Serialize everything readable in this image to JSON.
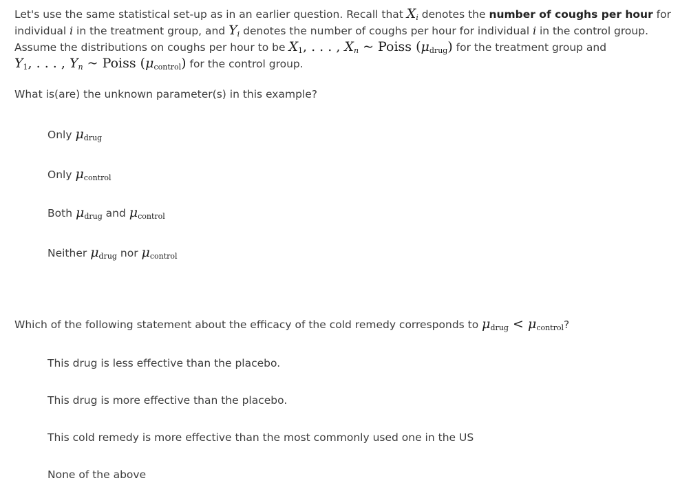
{
  "intro": {
    "l1_a": "Let's use the same statistical set-up as in an earlier question. Recall that ",
    "l1_b": " denotes the ",
    "l1_bold": "number of coughs per hour",
    "l1_c": " for",
    "l2_a": "individual ",
    "l2_b": " in the treatment group, and ",
    "l2_c": " denotes the number of coughs per hour for individual ",
    "l2_d": " in the control group.",
    "l3_a": "Assume the distributions on coughs per hour to be ",
    "l3_b": " for the treatment group and",
    "l4_b": " for the control group."
  },
  "math": {
    "X": "X",
    "Y": "Y",
    "i": "i",
    "n": "n",
    "one": "1",
    "ellipsis": ", . . . , ",
    "tilde": " ~ ",
    "poiss": "Poiss",
    "lp": "(",
    "rp": ")",
    "mu": "μ",
    "drug": "drug",
    "control": "control",
    "lt": " < ",
    "qmark": "?"
  },
  "question1": {
    "text": "What is(are) the unknown parameter(s) in this example?",
    "options": [
      {
        "prefix": "Only "
      },
      {
        "prefix": "Only "
      },
      {
        "prefix": "Both ",
        "mid": " and "
      },
      {
        "prefix": "Neither ",
        "mid": " nor "
      }
    ]
  },
  "question2": {
    "text": "Which of the following statement about the efficacy of the cold remedy corresponds to ",
    "options": [
      "This drug is less effective than the placebo.",
      "This drug is more effective than the placebo.",
      "This cold remedy is more effective than the most commonly used one in the US",
      "None of the above"
    ]
  }
}
